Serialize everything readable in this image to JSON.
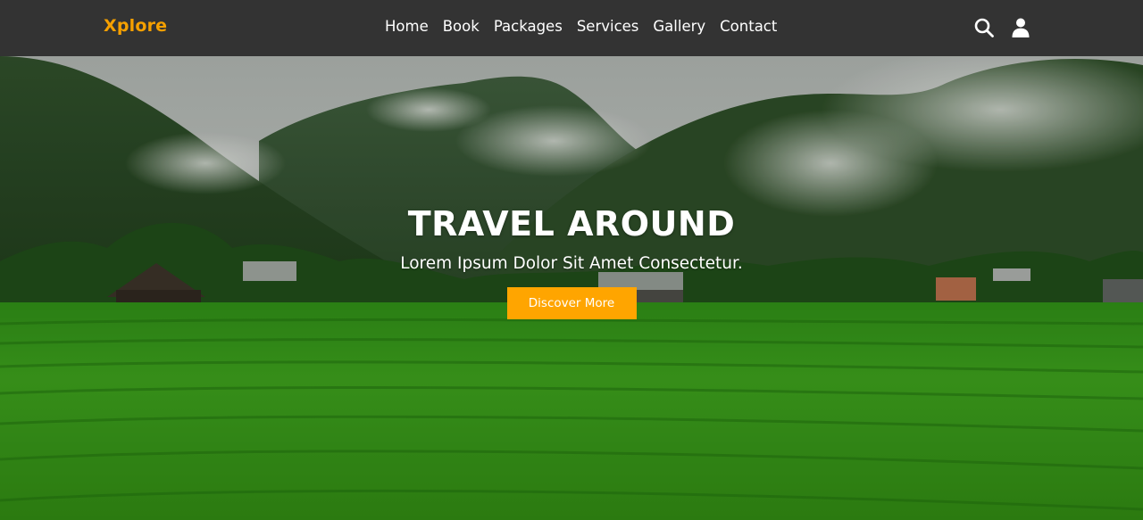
{
  "brand": {
    "logo": "Xplore",
    "accent": "#f5a000"
  },
  "nav": {
    "items": [
      {
        "label": "Home"
      },
      {
        "label": "Book"
      },
      {
        "label": "Packages"
      },
      {
        "label": "Services"
      },
      {
        "label": "Gallery"
      },
      {
        "label": "Contact"
      }
    ],
    "icons": [
      "search-icon",
      "user-icon"
    ]
  },
  "hero": {
    "title": "TRAVEL AROUND",
    "subtitle": "Lorem Ipsum Dolor Sit Amet Consectetur.",
    "button_label": "Discover More",
    "button_color": "#ffa500"
  }
}
